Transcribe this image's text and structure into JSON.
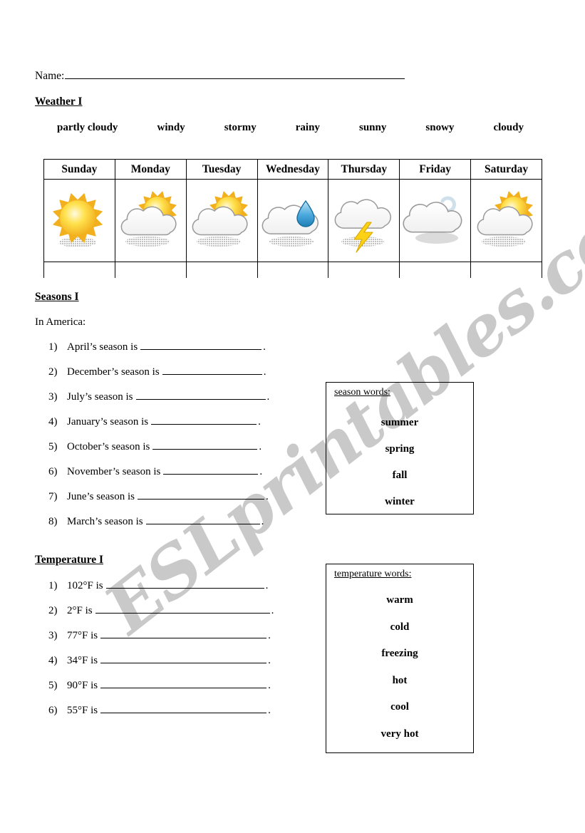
{
  "worksheet": {
    "name_label": "Name:",
    "in_america": "In America:"
  },
  "sections": {
    "weather": {
      "heading": "Weather I"
    },
    "seasons": {
      "heading": "Seasons I"
    },
    "temperature": {
      "heading": "Temperature I"
    }
  },
  "weather_words": [
    "partly cloudy",
    "windy",
    "stormy",
    "rainy",
    "sunny",
    "snowy",
    "cloudy"
  ],
  "weather_table": {
    "days": [
      "Sunday",
      "Monday",
      "Tuesday",
      "Wednesday",
      "Thursday",
      "Friday",
      "Saturday"
    ],
    "icons": [
      "sun-icon",
      "sun-behind-cloud-icon",
      "sun-behind-cloud-icon",
      "cloud-with-raindrop-icon",
      "cloud-with-lightning-icon",
      "cloud-with-wind-icon",
      "sun-behind-cloud-icon"
    ],
    "answer_row": [
      "",
      "",
      "",
      "",
      "",
      "",
      ""
    ]
  },
  "seasons_questions": [
    {
      "num": "1)",
      "prompt": "April’s season is",
      "blank_width": 170,
      "answer": ""
    },
    {
      "num": "2)",
      "prompt": "December’s season is",
      "blank_width": 140,
      "answer": ""
    },
    {
      "num": "3)",
      "prompt": "July’s season is",
      "blank_width": 182,
      "answer": ""
    },
    {
      "num": "4)",
      "prompt": "January’s season is",
      "blank_width": 148,
      "answer": ""
    },
    {
      "num": "5)",
      "prompt": "October’s season is",
      "blank_width": 147,
      "answer": ""
    },
    {
      "num": "6)",
      "prompt": "November’s season is",
      "blank_width": 133,
      "answer": ""
    },
    {
      "num": "7)",
      "prompt": "June’s season is",
      "blank_width": 178,
      "answer": ""
    },
    {
      "num": "8)",
      "prompt": "March’s season is",
      "blank_width": 160,
      "answer": ""
    }
  ],
  "season_word_box": {
    "title": "season words:",
    "words": [
      "summer",
      "spring",
      "fall",
      "winter"
    ]
  },
  "temperature_questions": [
    {
      "num": "1)",
      "prompt": "102°F is",
      "blank_width": 222,
      "answer": ""
    },
    {
      "num": "2)",
      "prompt": "2°F is",
      "blank_width": 245,
      "answer": ""
    },
    {
      "num": "3)",
      "prompt": "77°F is",
      "blank_width": 233,
      "answer": ""
    },
    {
      "num": "4)",
      "prompt": "34°F is",
      "blank_width": 233,
      "answer": ""
    },
    {
      "num": "5)",
      "prompt": "90°F is",
      "blank_width": 233,
      "answer": ""
    },
    {
      "num": "6)",
      "prompt": "55°F is",
      "blank_width": 233,
      "answer": ""
    }
  ],
  "temperature_word_box": {
    "title": "temperature words:",
    "words": [
      "warm",
      "cold",
      "freezing",
      "hot",
      "cool",
      "very hot"
    ]
  },
  "watermark": {
    "text": "ESLprintables.com",
    "color": "#c9c9c9"
  },
  "colors": {
    "sun_outer": "#f2b01e",
    "sun_inner": "#ffe14d",
    "sun_core": "#fffbe0",
    "cloud_fill": "#ffffff",
    "cloud_stroke": "#9a9a9a",
    "cloud_shadow": "#bdbdbd",
    "raindrop": "#49a8dc",
    "lightning": "#fcd116",
    "wind": "#cfe0ea",
    "rule": "#000000"
  }
}
